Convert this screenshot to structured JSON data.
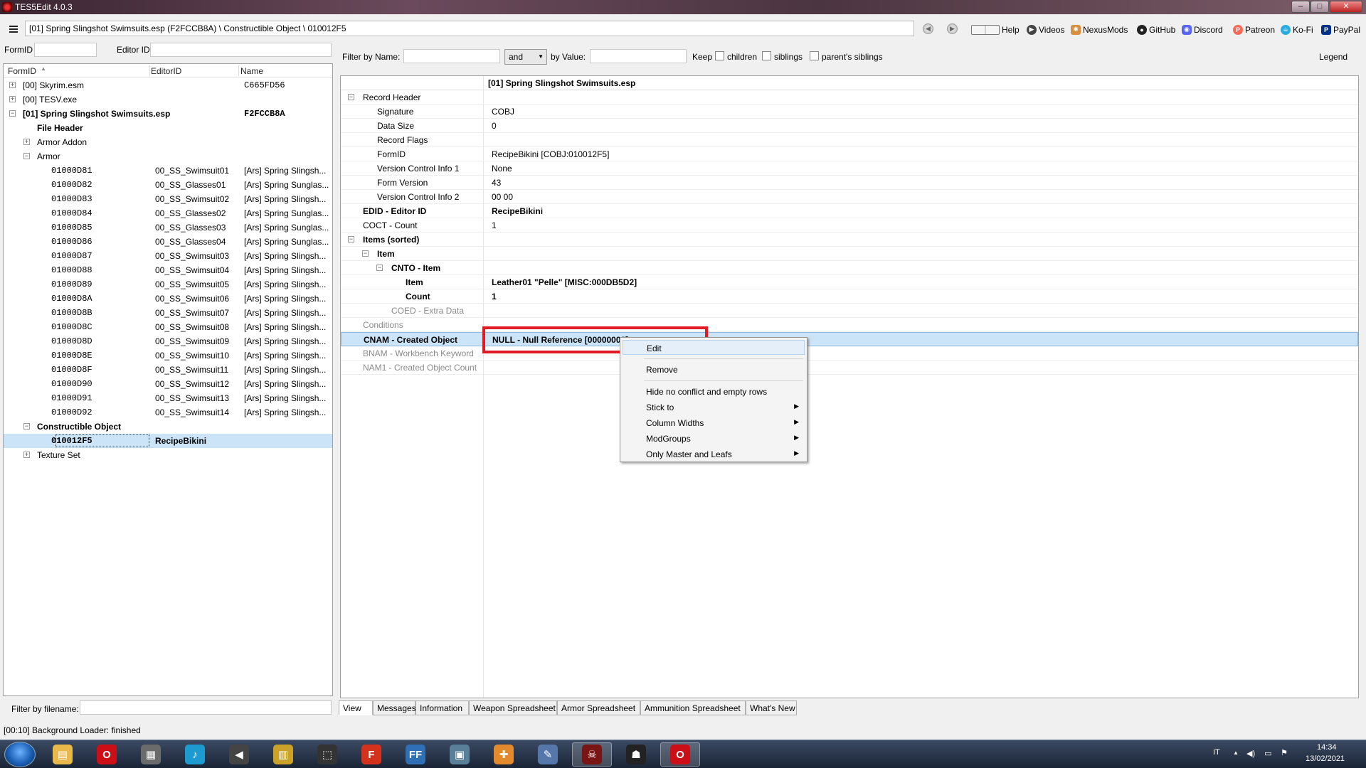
{
  "window": {
    "title": "TES5Edit 4.0.3",
    "btn_min": "–",
    "btn_max": "□",
    "btn_close": "✕"
  },
  "topbar": {
    "path": "[01] Spring Slingshot Swimsuits.esp (F2FCCB8A) \\ Constructible Object \\ 010012F5",
    "nav_back": "◀",
    "nav_fwd": "▶",
    "buttons": [
      "Help",
      "Videos",
      "NexusMods",
      "GitHub",
      "Discord",
      "Patreon",
      "Ko-Fi",
      "PayPal"
    ]
  },
  "left": {
    "formid_label": "FormID",
    "editorid_label": "Editor ID",
    "columns": [
      "FormID",
      "EditorID",
      "Name"
    ],
    "sort_arrow": "▲",
    "tree": [
      {
        "exp": "+",
        "indent": 0,
        "c1": "[00] Skyrim.esm",
        "c2": "",
        "c3": "C665FD56",
        "bold": false
      },
      {
        "exp": "+",
        "indent": 0,
        "c1": "[00] TESV.exe",
        "c2": "",
        "c3": "",
        "bold": false
      },
      {
        "exp": "−",
        "indent": 0,
        "c1": "[01] Spring Slingshot Swimsuits.esp",
        "c2": "",
        "c3": "F2FCCB8A",
        "bold": true
      },
      {
        "exp": "",
        "indent": 1,
        "c1": "File Header",
        "c2": "",
        "c3": "",
        "bold": true
      },
      {
        "exp": "+",
        "indent": 1,
        "c1": "Armor Addon",
        "c2": "",
        "c3": "",
        "bold": false
      },
      {
        "exp": "−",
        "indent": 1,
        "c1": "Armor",
        "c2": "",
        "c3": "",
        "bold": false
      },
      {
        "exp": "",
        "indent": 2,
        "c1": "01000D81",
        "c2": "00_SS_Swimsuit01",
        "c3": "[Ars] Spring Slingsh...",
        "mono": true
      },
      {
        "exp": "",
        "indent": 2,
        "c1": "01000D82",
        "c2": "00_SS_Glasses01",
        "c3": "[Ars] Spring Sunglas...",
        "mono": true
      },
      {
        "exp": "",
        "indent": 2,
        "c1": "01000D83",
        "c2": "00_SS_Swimsuit02",
        "c3": "[Ars] Spring Slingsh...",
        "mono": true
      },
      {
        "exp": "",
        "indent": 2,
        "c1": "01000D84",
        "c2": "00_SS_Glasses02",
        "c3": "[Ars] Spring Sunglas...",
        "mono": true
      },
      {
        "exp": "",
        "indent": 2,
        "c1": "01000D85",
        "c2": "00_SS_Glasses03",
        "c3": "[Ars] Spring Sunglas...",
        "mono": true
      },
      {
        "exp": "",
        "indent": 2,
        "c1": "01000D86",
        "c2": "00_SS_Glasses04",
        "c3": "[Ars] Spring Sunglas...",
        "mono": true
      },
      {
        "exp": "",
        "indent": 2,
        "c1": "01000D87",
        "c2": "00_SS_Swimsuit03",
        "c3": "[Ars] Spring Slingsh...",
        "mono": true
      },
      {
        "exp": "",
        "indent": 2,
        "c1": "01000D88",
        "c2": "00_SS_Swimsuit04",
        "c3": "[Ars] Spring Slingsh...",
        "mono": true
      },
      {
        "exp": "",
        "indent": 2,
        "c1": "01000D89",
        "c2": "00_SS_Swimsuit05",
        "c3": "[Ars] Spring Slingsh...",
        "mono": true
      },
      {
        "exp": "",
        "indent": 2,
        "c1": "01000D8A",
        "c2": "00_SS_Swimsuit06",
        "c3": "[Ars] Spring Slingsh...",
        "mono": true
      },
      {
        "exp": "",
        "indent": 2,
        "c1": "01000D8B",
        "c2": "00_SS_Swimsuit07",
        "c3": "[Ars] Spring Slingsh...",
        "mono": true
      },
      {
        "exp": "",
        "indent": 2,
        "c1": "01000D8C",
        "c2": "00_SS_Swimsuit08",
        "c3": "[Ars] Spring Slingsh...",
        "mono": true
      },
      {
        "exp": "",
        "indent": 2,
        "c1": "01000D8D",
        "c2": "00_SS_Swimsuit09",
        "c3": "[Ars] Spring Slingsh...",
        "mono": true
      },
      {
        "exp": "",
        "indent": 2,
        "c1": "01000D8E",
        "c2": "00_SS_Swimsuit10",
        "c3": "[Ars] Spring Slingsh...",
        "mono": true
      },
      {
        "exp": "",
        "indent": 2,
        "c1": "01000D8F",
        "c2": "00_SS_Swimsuit11",
        "c3": "[Ars] Spring Slingsh...",
        "mono": true
      },
      {
        "exp": "",
        "indent": 2,
        "c1": "01000D90",
        "c2": "00_SS_Swimsuit12",
        "c3": "[Ars] Spring Slingsh...",
        "mono": true
      },
      {
        "exp": "",
        "indent": 2,
        "c1": "01000D91",
        "c2": "00_SS_Swimsuit13",
        "c3": "[Ars] Spring Slingsh...",
        "mono": true
      },
      {
        "exp": "",
        "indent": 2,
        "c1": "01000D92",
        "c2": "00_SS_Swimsuit14",
        "c3": "[Ars] Spring Slingsh...",
        "mono": true
      },
      {
        "exp": "−",
        "indent": 1,
        "c1": "Constructible Object",
        "c2": "",
        "c3": "",
        "bold": true
      },
      {
        "exp": "",
        "indent": 2,
        "c1": "010012F5",
        "c2": "RecipeBikini",
        "c3": "",
        "bold": true,
        "mono": true,
        "selected": true
      },
      {
        "exp": "+",
        "indent": 1,
        "c1": "Texture Set",
        "c2": "",
        "c3": "",
        "bold": false
      }
    ],
    "filter_by_filename": "Filter by filename:"
  },
  "right": {
    "filter_by_name": "Filter by Name:",
    "and_select": "and",
    "by_value": "by Value:",
    "keep": "Keep",
    "children": "children",
    "siblings": "siblings",
    "parents_siblings": "parent's siblings",
    "legend": "Legend",
    "header_title": "[01] Spring Slingshot Swimsuits.esp",
    "rows": [
      {
        "exp": "−",
        "indent": 0,
        "k": "Record Header",
        "v": "",
        "kb": false,
        "vb": false
      },
      {
        "exp": "",
        "indent": 1,
        "k": "Signature",
        "v": "COBJ"
      },
      {
        "exp": "",
        "indent": 1,
        "k": "Data Size",
        "v": "0"
      },
      {
        "exp": "",
        "indent": 1,
        "k": "Record Flags",
        "v": ""
      },
      {
        "exp": "",
        "indent": 1,
        "k": "FormID",
        "v": "RecipeBikini [COBJ:010012F5]"
      },
      {
        "exp": "",
        "indent": 1,
        "k": "Version Control Info 1",
        "v": "None"
      },
      {
        "exp": "",
        "indent": 1,
        "k": "Form Version",
        "v": "43"
      },
      {
        "exp": "",
        "indent": 1,
        "k": "Version Control Info 2",
        "v": "00 00"
      },
      {
        "exp": "",
        "indent": 0,
        "k": "EDID - Editor ID",
        "v": "RecipeBikini",
        "kb": true,
        "vb": true
      },
      {
        "exp": "",
        "indent": 0,
        "k": "COCT - Count",
        "v": "1"
      },
      {
        "exp": "−",
        "indent": 0,
        "k": "Items (sorted)",
        "v": "",
        "kb": true
      },
      {
        "exp": "−",
        "indent": 1,
        "k": "Item",
        "v": "",
        "kb": true
      },
      {
        "exp": "−",
        "indent": 2,
        "k": "CNTO - Item",
        "v": "",
        "kb": true
      },
      {
        "exp": "",
        "indent": 3,
        "k": "Item",
        "v": "Leather01 \"Pelle\" [MISC:000DB5D2]",
        "kb": true,
        "vb": true
      },
      {
        "exp": "",
        "indent": 3,
        "k": "Count",
        "v": "1",
        "kb": true,
        "vb": true
      },
      {
        "exp": "",
        "indent": 2,
        "k": "COED - Extra Data",
        "v": "",
        "grey": true
      },
      {
        "exp": "",
        "indent": 0,
        "k": "Conditions",
        "v": "",
        "grey": true
      },
      {
        "exp": "",
        "indent": 0,
        "k": "CNAM - Created Object",
        "v": "NULL - Null Reference [00000000]",
        "kb": true,
        "vb": true,
        "highlight": true
      },
      {
        "exp": "",
        "indent": 0,
        "k": "BNAM - Workbench Keyword",
        "v": "",
        "grey": true
      },
      {
        "exp": "",
        "indent": 0,
        "k": "NAM1 - Created Object Count",
        "v": "",
        "grey": true
      }
    ]
  },
  "context_menu": {
    "items": [
      {
        "label": "Edit",
        "sub": false,
        "hover": true
      },
      {
        "sep": true
      },
      {
        "label": "Remove",
        "sub": false
      },
      {
        "sep": true
      },
      {
        "label": "Hide no conflict and empty rows",
        "sub": false
      },
      {
        "label": "Stick to",
        "sub": true
      },
      {
        "label": "Column Widths",
        "sub": true
      },
      {
        "label": "ModGroups",
        "sub": true
      },
      {
        "label": "Only Master and Leafs",
        "sub": true
      }
    ]
  },
  "tabs": [
    "View",
    "Messages",
    "Information",
    "Weapon Spreadsheet",
    "Armor Spreadsheet",
    "Ammunition Spreadsheet",
    "What's New"
  ],
  "status": "[00:10] Background Loader: finished",
  "taskbar": {
    "apps": [
      {
        "name": "explorer",
        "color": "#e8b84a",
        "glyph": "▤"
      },
      {
        "name": "opera",
        "color": "#cc0f16",
        "glyph": "O"
      },
      {
        "name": "film",
        "color": "#6b6b6b",
        "glyph": "▦"
      },
      {
        "name": "music",
        "color": "#1d9bd1",
        "glyph": "♪"
      },
      {
        "name": "speaker",
        "color": "#444444",
        "glyph": "◀"
      },
      {
        "name": "archive",
        "color": "#c9a227",
        "glyph": "▥"
      },
      {
        "name": "boot",
        "color": "#333333",
        "glyph": "⬚"
      },
      {
        "name": "foxit",
        "color": "#d4321d",
        "glyph": "F"
      },
      {
        "name": "ffdec",
        "color": "#2f6fb3",
        "glyph": "FF"
      },
      {
        "name": "window",
        "color": "#5a7f99",
        "glyph": "▣"
      },
      {
        "name": "puzzle",
        "color": "#e28a2c",
        "glyph": "✚"
      },
      {
        "name": "feather",
        "color": "#5577aa",
        "glyph": "✎"
      },
      {
        "name": "xedit",
        "color": "#7a1515",
        "glyph": "☠",
        "active": true
      },
      {
        "name": "people",
        "color": "#222222",
        "glyph": "☗"
      },
      {
        "name": "opera2",
        "color": "#cc0f16",
        "glyph": "O",
        "active": true
      }
    ],
    "lang": "IT",
    "tray_up": "▲",
    "volume": "◀)",
    "network": "▭",
    "flag": "⚑",
    "time": "14:34",
    "date": "13/02/2021"
  },
  "colors": {
    "accent_blue": "#cce4f7",
    "red_box": "#e01b24"
  }
}
